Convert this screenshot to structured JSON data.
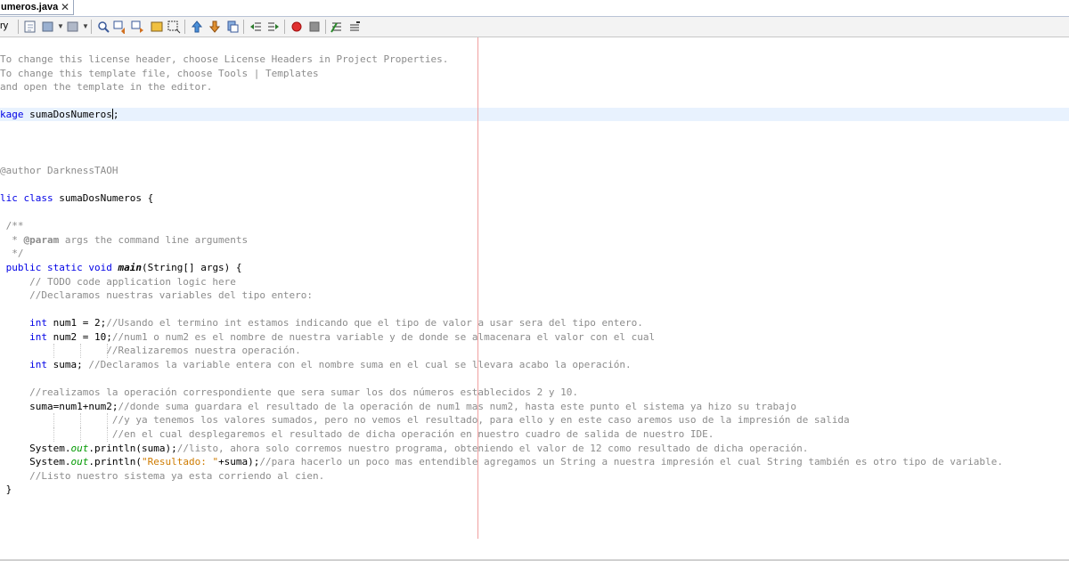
{
  "tab": {
    "title": "umeros.java",
    "close": "✕"
  },
  "toolbar": {
    "history_label": "ry",
    "buttons": [
      "source-icon",
      "toggle-icon",
      "back-icon",
      "forward-icon",
      "find-icon",
      "find-previous-icon",
      "find-next-icon",
      "toggle-highlight-icon",
      "toggle-rect-select-icon",
      "previous-bookmark-icon",
      "next-bookmark-icon",
      "toggle-bookmark-icon",
      "shift-left-icon",
      "shift-right-icon",
      "start-macro-icon",
      "stop-macro-icon",
      "comment-icon",
      "uncomment-icon"
    ]
  },
  "code": {
    "license1": "To change this license header, choose License Headers in Project Properties.",
    "license2": "To change this template file, choose Tools | Templates",
    "license3": "and open the template in the editor.",
    "package_kw": "kage",
    "package_name": " sumaDosNumeros",
    "package_semi": ";",
    "author": "@author DarknessTAOH",
    "class_kw": "lic class",
    "class_rest": " sumaDosNumeros {",
    "jd_open": " /**",
    "jd_param_pre": "  * ",
    "jd_param_tag": "@param",
    "jd_param_rest": " args the command line arguments",
    "jd_close": "  */",
    "main_kw": " public static void",
    "main_name": "main",
    "main_rest": "(String[] args) {",
    "todo": "     // TODO code application logic here",
    "declaramos": "     //Declaramos nuestras variables del tipo entero:",
    "num1_kw": "     int",
    "num1_code": " num1 = 2;",
    "num1_comment": "//Usando el termino int estamos indicando que el tipo de valor a usar sera del tipo entero.",
    "num2_kw": "     int",
    "num2_code": " num2 = 10;",
    "num2_comment": "//num1 o num2 es el nombre de nuestra variable y de donde se almacenara el valor con el cual",
    "realizaremos": "                  //Realizaremos nuestra operación.",
    "suma_kw": "     int",
    "suma_code": " suma;",
    "suma_comment": " //Declaramos la variable entera con el nombre suma en el cual se llevara acabo la operación.",
    "realizamos": "     //realizamos la operación correspondiente que sera sumar los dos números establecidos 2 y 10.",
    "assign_code": "     suma=num1+num2;",
    "assign_comment": "//donde suma guardara el resultado de la operación de num1 mas num2, hasta este punto el sistema ya hizo su trabajo",
    "cont1": "                   //y ya tenemos los valores sumados, pero no vemos el resultado, para ello y en este caso aremos uso de la impresión de salida",
    "cont2": "                   //en el cual desplegaremos el resultado de dicha operación en nuestro cuadro de salida de nuestro IDE.",
    "print1_a": "     System.",
    "print1_out": "out",
    "print1_b": ".println(suma);",
    "print1_comment": "//listo, ahora solo corremos nuestro programa, obteniendo el valor de 12 como resultado de dicha operación.",
    "print2_a": "     System.",
    "print2_out": "out",
    "print2_b": ".println(",
    "print2_str": "\"Resultado: \"",
    "print2_c": "+suma);",
    "print2_comment": "//para hacerlo un poco mas entendible agregamos un String a nuestra impresión el cual String también es otro tipo de variable.",
    "listo": "     //Listo nuestro sistema ya esta corriendo al cien.",
    "close_brace": " }"
  },
  "colors": {
    "keyword": "#0000e6",
    "comment": "#8c8c8c",
    "string": "#ce7b00",
    "field": "#009900",
    "current_line": "#e8f2fe",
    "margin_line": "#f0a0a0"
  }
}
